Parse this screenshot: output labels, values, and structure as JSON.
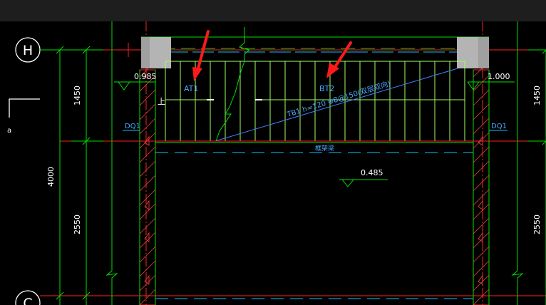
{
  "axes": {
    "top_axis": "H",
    "bottom_axis": "C"
  },
  "dimensions": {
    "left_upper": "1450",
    "left_lower": "2550",
    "left_total": "4000",
    "right_upper": "1450",
    "right_lower": "2550"
  },
  "labels": {
    "stair_left": "AT1",
    "stair_right": "BT2",
    "beam_left": "DQ1",
    "beam_right": "DQ1",
    "stair_note": "TB1 h=120 ⊕8@150(双层双向)",
    "beam_below": "框架梁",
    "up_marker": "上",
    "small_a": "a"
  },
  "elevations": {
    "left": "0.985",
    "right": "1.000",
    "mid": "0.485"
  },
  "colors": {
    "background": "#000000",
    "title_bar": "#1e1e1e",
    "red_axis": "#ff2020",
    "green": "#00e000",
    "cyan": "#00c8ff",
    "light_green": "#a0ff60",
    "white": "#ffffff",
    "column_grey": "#a0a0a0",
    "arrow_red": "#ff1a1a"
  }
}
